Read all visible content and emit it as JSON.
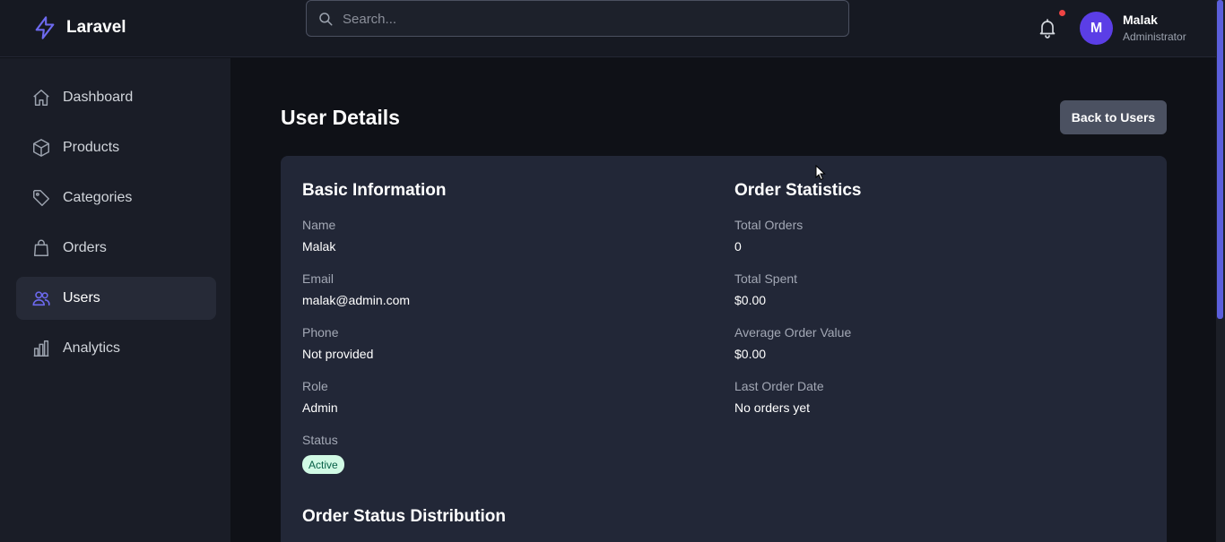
{
  "brand": {
    "name": "Laravel",
    "icon": "bolt-icon"
  },
  "search": {
    "placeholder": "Search..."
  },
  "user": {
    "initial": "M",
    "name": "Malak",
    "role": "Administrator"
  },
  "sidebar": {
    "items": [
      {
        "label": "Dashboard",
        "icon": "home-icon"
      },
      {
        "label": "Products",
        "icon": "cube-icon"
      },
      {
        "label": "Categories",
        "icon": "tag-icon"
      },
      {
        "label": "Orders",
        "icon": "shopping-bag-icon"
      },
      {
        "label": "Users",
        "icon": "users-icon",
        "active": true
      },
      {
        "label": "Analytics",
        "icon": "chart-bar-icon"
      }
    ]
  },
  "page": {
    "title": "User Details",
    "back_label": "Back to Users"
  },
  "basic": {
    "title": "Basic Information",
    "name_label": "Name",
    "name": "Malak",
    "email_label": "Email",
    "email": "malak@admin.com",
    "phone_label": "Phone",
    "phone": "Not provided",
    "role_label": "Role",
    "role": "Admin",
    "status_label": "Status",
    "status": "Active"
  },
  "stats": {
    "title": "Order Statistics",
    "total_orders_label": "Total Orders",
    "total_orders": "0",
    "total_spent_label": "Total Spent",
    "total_spent": "$0.00",
    "avg_label": "Average Order Value",
    "avg": "$0.00",
    "last_label": "Last Order Date",
    "last": "No orders yet"
  },
  "distribution": {
    "title": "Order Status Distribution"
  },
  "colors": {
    "accent": "#5b3ee6",
    "active_badge_bg": "#d1fae5",
    "active_badge_text": "#065f46",
    "notification": "#ef4444"
  }
}
